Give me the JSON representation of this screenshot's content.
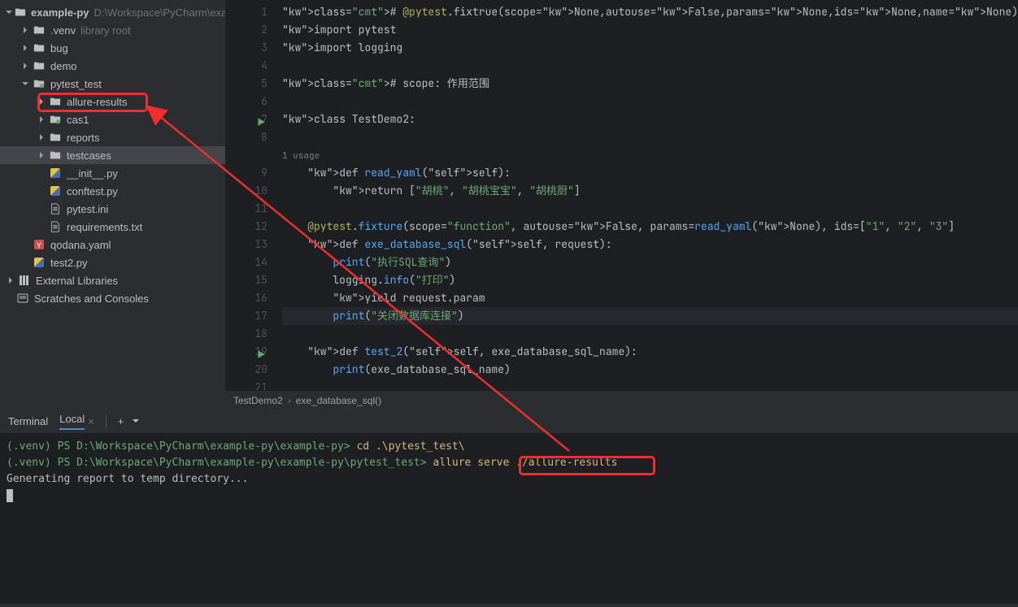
{
  "sidebar": {
    "root": {
      "name": "example-py",
      "path": "D:\\Workspace\\PyCharm\\example-py\\example"
    },
    "items": [
      {
        "name": ".venv",
        "hint": "library root"
      },
      {
        "name": "bug"
      },
      {
        "name": "demo"
      },
      {
        "name": "pytest_test"
      },
      {
        "name": "allure-results"
      },
      {
        "name": "cas1"
      },
      {
        "name": "reports"
      },
      {
        "name": "testcases"
      },
      {
        "name": "__init__.py"
      },
      {
        "name": "conftest.py"
      },
      {
        "name": "pytest.ini"
      },
      {
        "name": "requirements.txt"
      },
      {
        "name": "qodana.yaml"
      },
      {
        "name": "test2.py"
      }
    ],
    "external": "External Libraries",
    "scratches": "Scratches and Consoles"
  },
  "code": {
    "lines": [
      "# @pytest.fixtrue(scope=None,autouse=False,params=None,ids=None,name=None)",
      "import pytest",
      "import logging",
      "",
      "# scope: 作用范围",
      "",
      "class TestDemo2:",
      "",
      "1 usage",
      "    def read_yaml(self):",
      "        return [\"胡桃\", \"胡桃宝宝\", \"胡桃厨\"]",
      "",
      "    @pytest.fixture(scope=\"function\", autouse=False, params=read_yaml(None), ids=[\"1\", \"2\", \"3\"]",
      "    def exe_database_sql(self, request):",
      "        print(\"执行SQL查询\")",
      "        logging.info(\"打印\")",
      "        yield request.param",
      "        print(\"关闭数据库连接\")",
      "",
      "    def test_2(self, exe_database_sql_name):",
      "        print(exe_database_sql_name)",
      ""
    ],
    "line_numbers": [
      1,
      2,
      3,
      4,
      5,
      6,
      7,
      8,
      null,
      9,
      10,
      11,
      12,
      13,
      14,
      15,
      16,
      17,
      18,
      19,
      20,
      21
    ]
  },
  "breadcrumb": {
    "class": "TestDemo2",
    "method": "exe_database_sql()"
  },
  "terminal": {
    "tabs": {
      "main": "Terminal",
      "local": "Local"
    },
    "lines": [
      {
        "prompt": "(.venv) PS D:\\Workspace\\PyCharm\\example-py\\example-py>",
        "cmd": "cd .\\pytest_test\\"
      },
      {
        "prompt": "(.venv) PS D:\\Workspace\\PyCharm\\example-py\\example-py\\pytest_test>",
        "cmd": "allure serve ./allure-results"
      },
      {
        "text": "Generating report to temp directory..."
      }
    ]
  }
}
